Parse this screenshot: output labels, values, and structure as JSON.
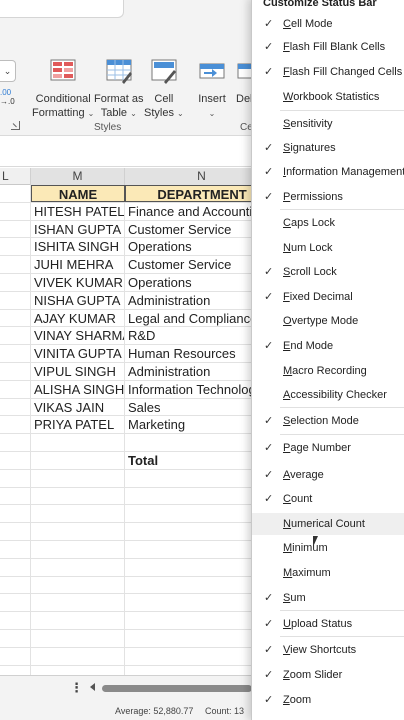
{
  "ribbon": {
    "partial_numbers": [
      ".00",
      "→.0"
    ],
    "buttons": [
      {
        "label1": "Conditional",
        "label2": "Formatting"
      },
      {
        "label1": "Format as",
        "label2": "Table"
      },
      {
        "label1": "Cell",
        "label2": "Styles"
      },
      {
        "label1": "Insert",
        "label2": ""
      },
      {
        "label1": "Del",
        "label2": ""
      }
    ],
    "group_styles": "Styles",
    "group_cells_partial": "Ce"
  },
  "sheet": {
    "col_left_partial": "L",
    "col_m": "M",
    "col_n": "N",
    "header_name": "NAME",
    "header_department": "DEPARTMENT",
    "rows": [
      {
        "name": "HITESH PATEL",
        "dept": "Finance and Accounting"
      },
      {
        "name": "ISHAN GUPTA",
        "dept": "Customer Service"
      },
      {
        "name": "ISHITA SINGH",
        "dept": "Operations"
      },
      {
        "name": "JUHI MEHRA",
        "dept": "Customer Service"
      },
      {
        "name": "VIVEK KUMAR",
        "dept": "Operations"
      },
      {
        "name": "NISHA GUPTA",
        "dept": "Administration"
      },
      {
        "name": "AJAY KUMAR",
        "dept": "Legal and Compliance"
      },
      {
        "name": "VINAY SHARMA",
        "dept": "R&D"
      },
      {
        "name": "VINITA GUPTA",
        "dept": "Human Resources"
      },
      {
        "name": "VIPUL SINGH",
        "dept": "Administration"
      },
      {
        "name": "ALISHA SINGH",
        "dept": "Information Technology"
      },
      {
        "name": "VIKAS JAIN",
        "dept": "Sales"
      },
      {
        "name": "PRIYA PATEL",
        "dept": "Marketing"
      }
    ],
    "total_label": "Total"
  },
  "status": {
    "average": "Average:  52,880.77",
    "count": "Count: 13"
  },
  "menu": {
    "title": "Customize Status Bar",
    "items": [
      {
        "label": "Cell Mode",
        "checked": true
      },
      {
        "label": "Flash Fill Blank Cells",
        "checked": true
      },
      {
        "label": "Flash Fill Changed Cells",
        "checked": true
      },
      {
        "label": "Workbook Statistics",
        "checked": false
      },
      {
        "label": "Sensitivity",
        "checked": false
      },
      {
        "label": "Signatures",
        "checked": true
      },
      {
        "label": "Information Management Policy",
        "checked": true
      },
      {
        "label": "Permissions",
        "checked": true
      },
      {
        "label": "Caps Lock",
        "checked": false
      },
      {
        "label": "Num Lock",
        "checked": false
      },
      {
        "label": "Scroll Lock",
        "checked": true
      },
      {
        "label": "Fixed Decimal",
        "checked": true
      },
      {
        "label": "Overtype Mode",
        "checked": false
      },
      {
        "label": "End Mode",
        "checked": true
      },
      {
        "label": "Macro Recording",
        "checked": false
      },
      {
        "label": "Accessibility Checker",
        "checked": false
      },
      {
        "label": "Selection Mode",
        "checked": true
      },
      {
        "label": "Page Number",
        "checked": true
      },
      {
        "label": "Average",
        "checked": true
      },
      {
        "label": "Count",
        "checked": true
      },
      {
        "label": "Numerical Count",
        "checked": false
      },
      {
        "label": "Minimum",
        "checked": false
      },
      {
        "label": "Maximum",
        "checked": false
      },
      {
        "label": "Sum",
        "checked": true
      },
      {
        "label": "Upload Status",
        "checked": true
      },
      {
        "label": "View Shortcuts",
        "checked": true
      },
      {
        "label": "Zoom Slider",
        "checked": true
      },
      {
        "label": "Zoom",
        "checked": true
      }
    ]
  }
}
